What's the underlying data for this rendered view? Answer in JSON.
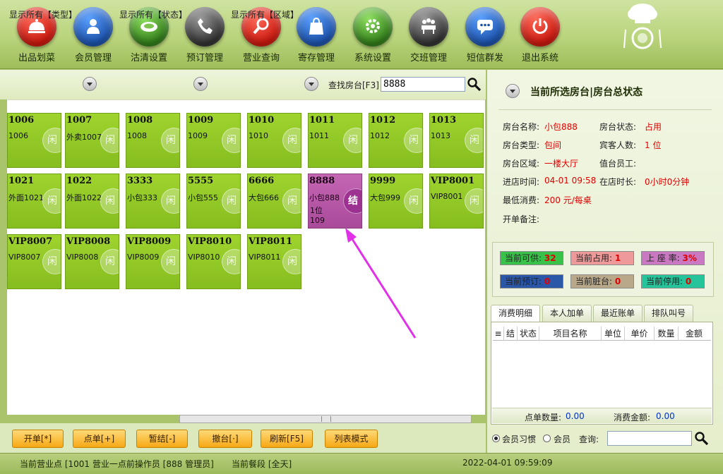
{
  "toolbar": {
    "items": [
      {
        "label": "出品划菜",
        "icon": "cloche-icon",
        "color": "#d8261c"
      },
      {
        "label": "会员管理",
        "icon": "member-icon",
        "color": "#1f5fb8"
      },
      {
        "label": "沽清设置",
        "icon": "plate-icon",
        "color": "#3d8a24"
      },
      {
        "label": "预订管理",
        "icon": "phone-icon",
        "color": "#4a4a4a"
      },
      {
        "label": "营业查询",
        "icon": "magnifier-icon",
        "color": "#d0261d"
      },
      {
        "label": "寄存管理",
        "icon": "bag-icon",
        "color": "#1f5fb8"
      },
      {
        "label": "系统设置",
        "icon": "gear-icon",
        "color": "#3d8a24"
      },
      {
        "label": "交班管理",
        "icon": "meeting-icon",
        "color": "#4a4a4a"
      },
      {
        "label": "短信群发",
        "icon": "chat-icon",
        "color": "#1f5fb8"
      },
      {
        "label": "退出系统",
        "icon": "power-icon",
        "color": "#d0261d"
      }
    ]
  },
  "filters": {
    "type": "显示所有【类型】",
    "status": "显示所有【状态】",
    "area": "显示所有【区域】",
    "find_label": "查找房台[F3]",
    "find_value": "8888"
  },
  "rooms": [
    {
      "code": "1006",
      "name": "1006"
    },
    {
      "code": "1007",
      "name": "外卖1007"
    },
    {
      "code": "1008",
      "name": "1008"
    },
    {
      "code": "1009",
      "name": "1009"
    },
    {
      "code": "1010",
      "name": "1010"
    },
    {
      "code": "1011",
      "name": "1011"
    },
    {
      "code": "1012",
      "name": "1012"
    },
    {
      "code": "1013",
      "name": "1013"
    },
    {
      "code": "1021",
      "name": "外面1021"
    },
    {
      "code": "1022",
      "name": "外面1022"
    },
    {
      "code": "3333",
      "name": "小包333"
    },
    {
      "code": "5555",
      "name": "小包555"
    },
    {
      "code": "6666",
      "name": "大包666"
    },
    {
      "code": "8888",
      "name": "小包888",
      "guests": "1位",
      "bill": "109",
      "badge": "结",
      "status": "occupied"
    },
    {
      "code": "9999",
      "name": "大包999"
    },
    {
      "code": "VIP8001",
      "name": "VIP8001"
    },
    {
      "code": "VIP8007",
      "name": "VIP8007"
    },
    {
      "code": "VIP8008",
      "name": "VIP8008"
    },
    {
      "code": "VIP8009",
      "name": "VIP8009"
    },
    {
      "code": "VIP8010",
      "name": "VIP8010"
    },
    {
      "code": "VIP8011",
      "name": "VIP8011"
    }
  ],
  "idle_badge": "闲",
  "actions": {
    "open": "开单[*]",
    "order": "点单[+]",
    "presettle": "暂结[-]",
    "cancel": "撤台[·]",
    "refresh": "刷新[F5]",
    "list_mode": "列表模式"
  },
  "panel": {
    "title": "当前所选房台|房台总状态",
    "room_name_label": "房台名称:",
    "room_name": "小包888",
    "room_status_label": "房台状态:",
    "room_status": "占用",
    "room_type_label": "房台类型:",
    "room_type": "包间",
    "guests_label": "宾客人数:",
    "guests": "1 位",
    "area_label": "房台区域:",
    "area": "一楼大厅",
    "staff_label": "值台员工:",
    "staff": "",
    "checkin_label": "进店时间:",
    "checkin": "04-01 09:58",
    "duration_label": "在店时长:",
    "duration": "0小时0分钟",
    "min_spend_label": "最低消费:",
    "min_spend": "200 元/每桌",
    "note_label": "开单备注:"
  },
  "stats": {
    "available_label": "当前可供:",
    "available": "32",
    "available_color": "#38c24a",
    "occupied_label": "当前占用:",
    "occupied": "1",
    "occupied_color": "#ef9a9a",
    "rate_label": "上 座 率:",
    "rate": "3%",
    "rate_color": "#c978c1",
    "reserved_label": "当前预订:",
    "reserved": "0",
    "reserved_color": "#2a57a7",
    "dirty_label": "当前脏台:",
    "dirty": "0",
    "dirty_color": "#b9a98a",
    "disabled_label": "当前停用:",
    "disabled": "0",
    "disabled_color": "#26c49a"
  },
  "tabs": [
    "消费明细",
    "本人加单",
    "最近账单",
    "排队叫号"
  ],
  "table": {
    "columns": [
      "结",
      "状态",
      "项目名称",
      "单位",
      "单价",
      "数量",
      "金额"
    ],
    "count_label": "点单数量:",
    "count": "0.00",
    "amount_label": "消费金额:",
    "amount": "0.00"
  },
  "search": {
    "opt_member_habit": "会员习惯",
    "opt_member": "会员",
    "query_label": "查询:"
  },
  "status": {
    "shop": "当前营业点 [1001 营业一点前操作员 [888 管理员]",
    "period": "当前餐段 [全天]",
    "datetime": "2022-04-01 09:59:09"
  }
}
